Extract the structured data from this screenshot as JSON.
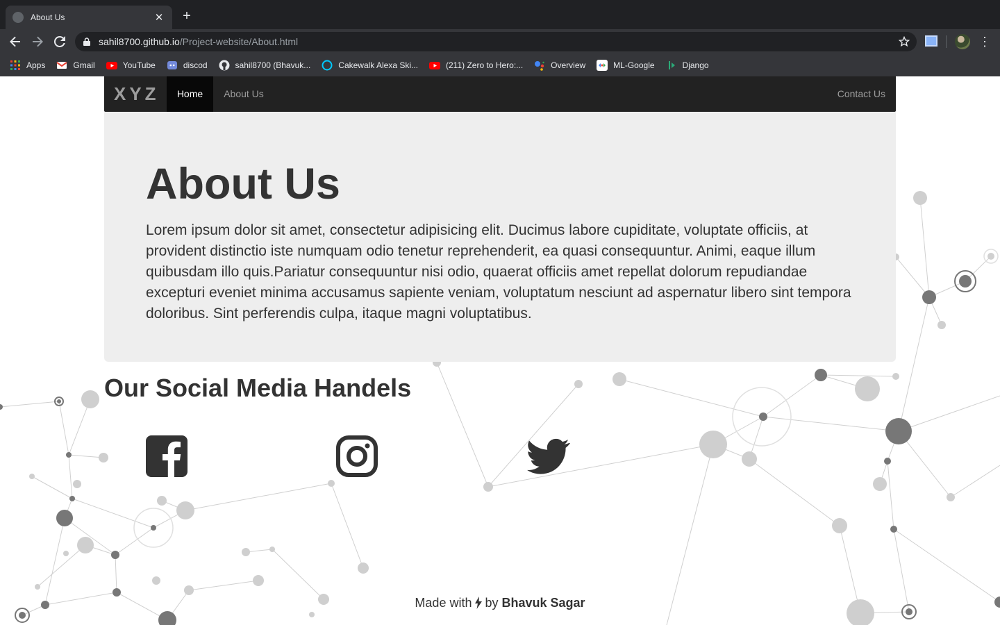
{
  "browser": {
    "tab_title": "About Us",
    "url_host": "sahil8700.github.io",
    "url_path": "/Project-website/About.html",
    "bookmarks": [
      {
        "label": "Apps",
        "icon": "apps-grid-icon"
      },
      {
        "label": "Gmail",
        "icon": "gmail-icon"
      },
      {
        "label": "YouTube",
        "icon": "youtube-icon"
      },
      {
        "label": "discod",
        "icon": "discord-icon"
      },
      {
        "label": "sahil8700 (Bhavuk...",
        "icon": "github-icon"
      },
      {
        "label": "Cakewalk Alexa Ski...",
        "icon": "alexa-icon"
      },
      {
        "label": "(211) Zero to Hero:...",
        "icon": "youtube-icon"
      },
      {
        "label": "Overview",
        "icon": "google-assistant-icon"
      },
      {
        "label": "ML-Google",
        "icon": "ml-google-icon"
      },
      {
        "label": "Django",
        "icon": "django-icon"
      }
    ]
  },
  "navbar": {
    "brand": "XYZ",
    "home": "Home",
    "about": "About Us",
    "contact": "Contact Us"
  },
  "jumbotron": {
    "title": "About Us",
    "text": "Lorem ipsum dolor sit amet, consectetur adipisicing elit. Ducimus labore cupiditate, voluptate officiis, at provident distinctio iste numquam odio tenetur reprehenderit, ea quasi consequuntur. Animi, eaque illum quibusdam illo quis.Pariatur consequuntur nisi odio, quaerat officiis amet repellat dolorum repudiandae excepturi eveniet minima accusamus sapiente veniam, voluptatum nesciunt ad aspernatur libero sint tempora doloribus. Sint perferendis culpa, itaque magni voluptatibus."
  },
  "social": {
    "heading": "Our Social Media Handels",
    "icons": [
      "facebook-icon",
      "instagram-icon",
      "twitter-icon"
    ]
  },
  "footer": {
    "prefix": "Made with",
    "middle": "by",
    "author": "Bhavuk Sagar"
  },
  "colors": {
    "navbar_bg": "#222222",
    "navbar_active": "#080808",
    "jumbotron_bg": "#eeeeee",
    "text": "#333333"
  }
}
